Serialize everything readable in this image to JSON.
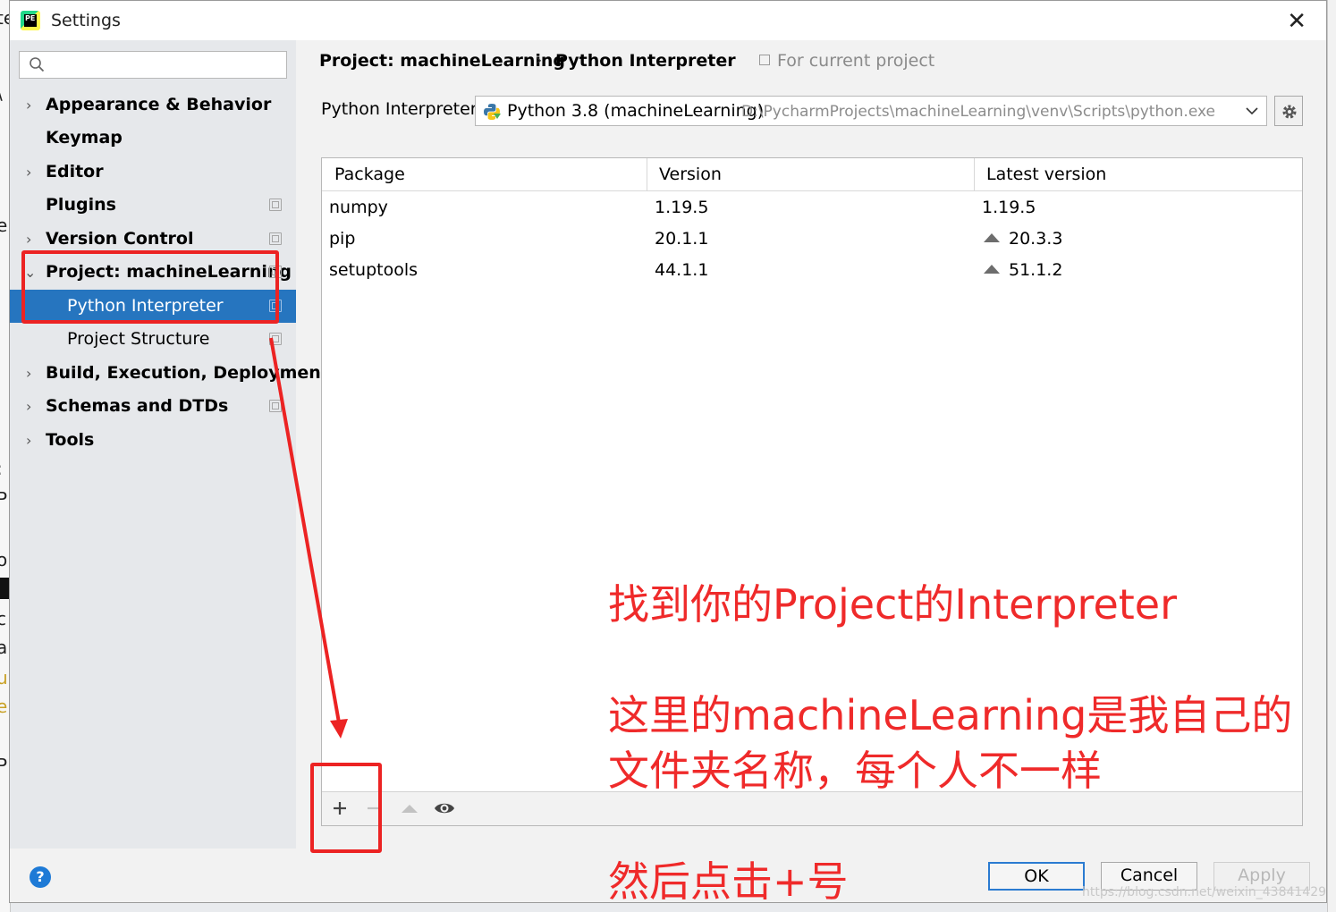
{
  "window": {
    "title": "Settings",
    "close_icon": "close-icon"
  },
  "sidebar": {
    "search_placeholder": "",
    "items": [
      {
        "label": "Appearance & Behavior",
        "expandable": true
      },
      {
        "label": "Keymap",
        "expandable": false
      },
      {
        "label": "Editor",
        "expandable": true
      },
      {
        "label": "Plugins",
        "expandable": false
      },
      {
        "label": "Version Control",
        "expandable": true
      },
      {
        "label": "Project: machineLearning",
        "expandable": true,
        "expanded": true
      },
      {
        "label": "Python Interpreter",
        "child": true,
        "selected": true
      },
      {
        "label": "Project Structure",
        "child": true
      },
      {
        "label": "Build, Execution, Deployment",
        "expandable": true
      },
      {
        "label": "Schemas and DTDs",
        "expandable": true
      },
      {
        "label": "Tools",
        "expandable": true
      }
    ]
  },
  "breadcrumb": {
    "project": "Project: machineLearning",
    "separator": "›",
    "current": "Python Interpreter",
    "scope": "For current project"
  },
  "interpreter": {
    "label": "Python Interpreter:",
    "name": "Python 3.8 (machineLearning)",
    "path": "D:\\PycharmProjects\\machineLearning\\venv\\Scripts\\python.exe"
  },
  "packages": {
    "columns": [
      "Package",
      "Version",
      "Latest version"
    ],
    "rows": [
      {
        "name": "numpy",
        "version": "1.19.5",
        "latest": "1.19.5",
        "upgrade": false
      },
      {
        "name": "pip",
        "version": "20.1.1",
        "latest": "20.3.3",
        "upgrade": true
      },
      {
        "name": "setuptools",
        "version": "44.1.1",
        "latest": "51.1.2",
        "upgrade": true
      }
    ]
  },
  "toolbar": {
    "add": "+",
    "remove": "−"
  },
  "buttons": {
    "ok": "OK",
    "cancel": "Cancel",
    "apply": "Apply",
    "help": "?"
  },
  "annotations": {
    "line1": "找到你的Project的Interpreter",
    "line2": "这里的machineLearning是我自己的",
    "line3": "文件夹名称，每个人不一样",
    "line4": "然后点击+号",
    "color": "#ef2a2a"
  },
  "watermark": "https://blog.csdn.net/weixin_43841429",
  "colors": {
    "selection": "#2675bf",
    "accent": "#2b7bd1"
  }
}
